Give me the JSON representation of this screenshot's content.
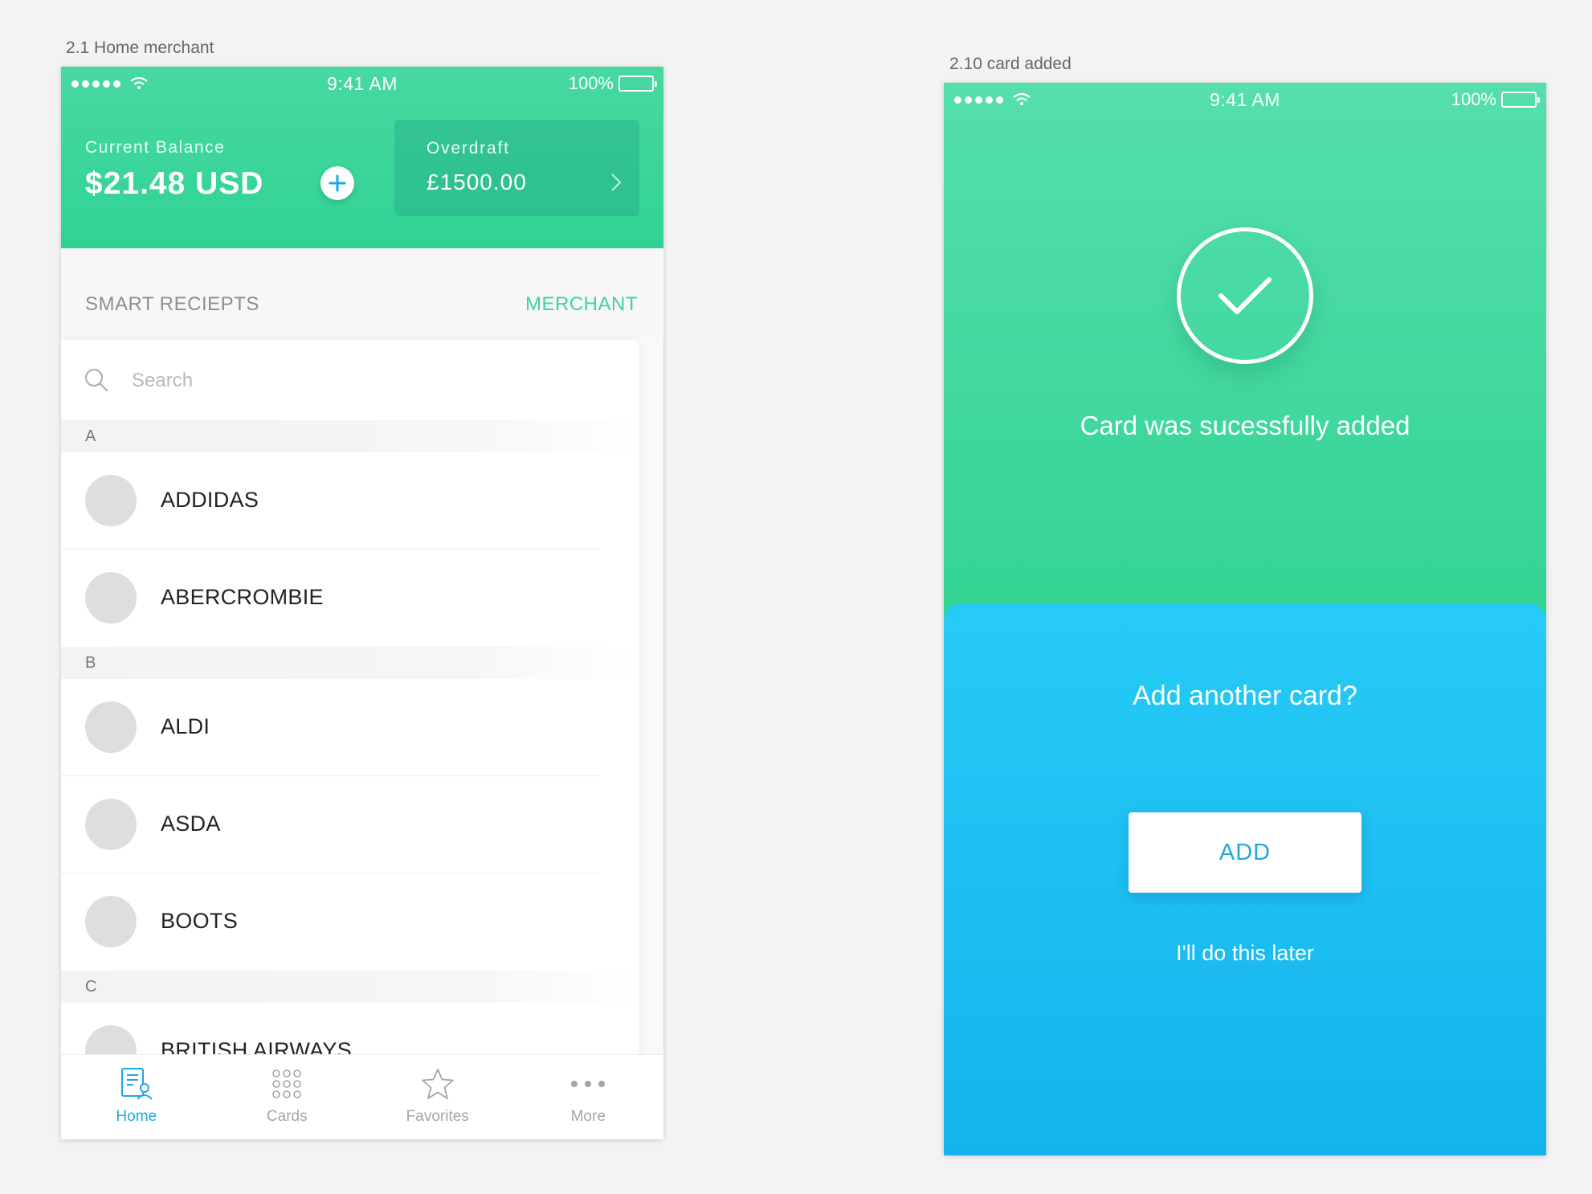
{
  "artboards": {
    "home_label": "2.1 Home merchant",
    "added_label": "2.10 card added"
  },
  "status_bar": {
    "time": "9:41 AM",
    "battery": "100%"
  },
  "home": {
    "balance_label": "Current Balance",
    "balance_amount": "$21.48 USD",
    "overdraft_label": "Overdraft",
    "overdraft_amount": "£1500.00",
    "section_title": "SMART RECIEPTS",
    "merchant_tab": "MERCHANT",
    "search_placeholder": "Search",
    "letters": [
      "A",
      "B",
      "C"
    ],
    "merchants": [
      "ADDIDAS",
      "ABERCROMBIE",
      "ALDI",
      "ASDA",
      "BOOTS",
      "BRITISH AIRWAYS"
    ],
    "tabs": [
      {
        "label": "Home",
        "icon": "receipt-user-icon",
        "active": true
      },
      {
        "label": "Cards",
        "icon": "grid-dots-icon",
        "active": false
      },
      {
        "label": "Favorites",
        "icon": "star-icon",
        "active": false
      },
      {
        "label": "More",
        "icon": "more-dots-icon",
        "active": false
      }
    ]
  },
  "card_added": {
    "success_message": "Card was sucessfully added",
    "prompt": "Add another card?",
    "add_button": "ADD",
    "later_link": "I'll do this later"
  },
  "colors": {
    "green_top": "#55dfad",
    "green_bottom": "#32d391",
    "blue_top": "#26cbf5",
    "blue_bottom": "#15b3ee",
    "accent_blue": "#1ea8e1",
    "accent_green": "#3fd49f"
  }
}
